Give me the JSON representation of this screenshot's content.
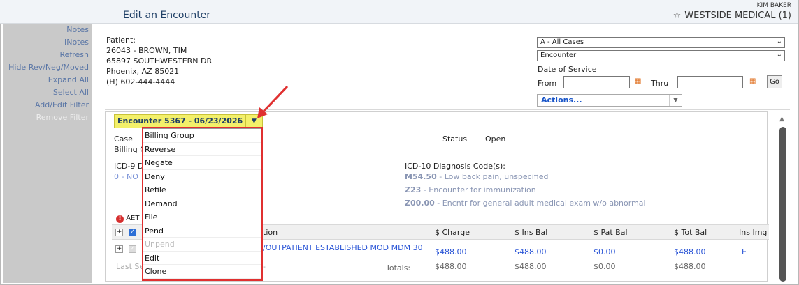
{
  "header": {
    "title": "Edit an Encounter",
    "user": "KIM BAKER",
    "practice": "WESTSIDE MEDICAL (1)"
  },
  "sidebar": {
    "items": [
      {
        "label": "Notes",
        "enabled": true
      },
      {
        "label": "INotes",
        "enabled": true
      },
      {
        "label": "Refresh",
        "enabled": true
      },
      {
        "label": "Hide Rev/Neg/Moved",
        "enabled": true
      },
      {
        "label": "Expand All",
        "enabled": true
      },
      {
        "label": "Select All",
        "enabled": true
      },
      {
        "label": "Add/Edit Filter",
        "enabled": true
      },
      {
        "label": "Remove Filter",
        "enabled": false
      }
    ]
  },
  "patient": {
    "label": "Patient:",
    "line1": "26043 - BROWN, TIM",
    "line2": "65897 SOUTHWESTERN DR",
    "line3": "Phoenix, AZ 85021",
    "line4": "(H) 602-444-4444"
  },
  "filters": {
    "case_select": "A - All Cases",
    "type_select": "Encounter",
    "date_of_service_label": "Date of Service",
    "from_label": "From",
    "thru_label": "Thru",
    "from_value": "",
    "thru_value": "",
    "go_label": "Go",
    "actions_label": "Actions..."
  },
  "encounter": {
    "header": "Encounter 5367 - 06/23/2026",
    "case_label": "Case",
    "billing_label": "Billing C",
    "status_label": "Status",
    "status_value": "Open",
    "icd9_label": "ICD-9 D",
    "icd9_value": "0 - NO",
    "icd10_label": "ICD-10 Diagnosis Code(s):",
    "icd10": [
      {
        "code": "M54.50",
        "desc": " - Low back pain, unspecified"
      },
      {
        "code": "Z23",
        "desc": " - Encounter for immunization"
      },
      {
        "code": "Z00.00",
        "desc": " - Encntr for general adult medical exam w/o abnormal"
      }
    ],
    "aet_label": "AET",
    "columns": {
      "description": "tion",
      "charge": "$ Charge",
      "ins_bal": "$ Ins Bal",
      "pat_bal": "$ Pat Bal",
      "tot_bal": "$ Tot Bal",
      "ins_img": "Ins Img"
    },
    "row": {
      "description": "/OUTPATIENT ESTABLISHED MOD MDM 30",
      "charge": "$488.00",
      "ins_bal": "$488.00",
      "pat_bal": "$0.00",
      "tot_bal": "$488.00",
      "ins_img": "E"
    },
    "last_label": "Last Se",
    "last_dash": "-",
    "totals_label": "Totals:",
    "totals": {
      "charge": "$488.00",
      "ins_bal": "$488.00",
      "pat_bal": "$0.00",
      "tot_bal": "$488.00"
    }
  },
  "menu": {
    "items": [
      {
        "label": "Billing Group",
        "enabled": true
      },
      {
        "label": "Reverse",
        "enabled": true
      },
      {
        "label": "Negate",
        "enabled": true
      },
      {
        "label": "Deny",
        "enabled": true
      },
      {
        "label": "Refile",
        "enabled": true
      },
      {
        "label": "Demand",
        "enabled": true
      },
      {
        "label": "File",
        "enabled": true
      },
      {
        "label": "Pend",
        "enabled": true
      },
      {
        "label": "Unpend",
        "enabled": false
      },
      {
        "label": "Edit",
        "enabled": true
      },
      {
        "label": "Clone",
        "enabled": true
      }
    ]
  },
  "colors": {
    "accent_yellow": "#f3f06a",
    "link_blue": "#2a55d6",
    "annotation_red": "#e03030"
  }
}
